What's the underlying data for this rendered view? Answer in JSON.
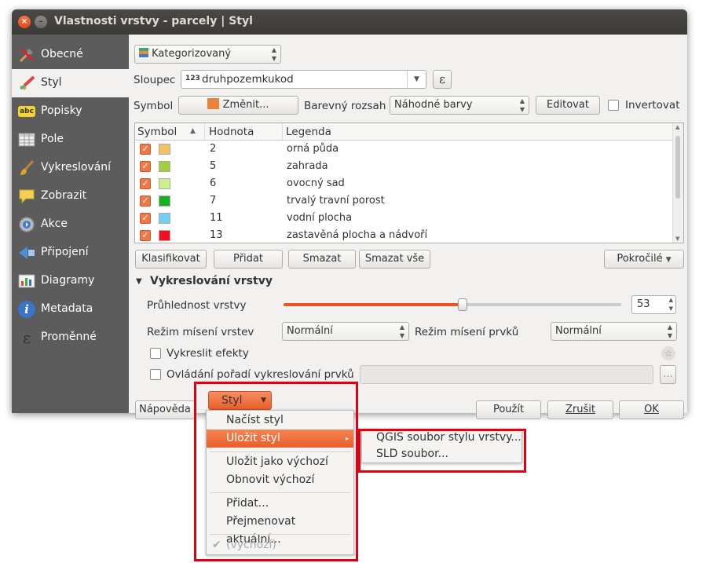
{
  "window": {
    "title": "Vlastnosti vrstvy - parcely | Styl"
  },
  "sidebar": {
    "items": [
      {
        "label": "Obecné",
        "icon": "tools-icon"
      },
      {
        "label": "Styl",
        "icon": "paintbrush-icon",
        "selected": true
      },
      {
        "label": "Popisky",
        "icon": "abc-label-icon",
        "icon_text": "abc"
      },
      {
        "label": "Pole",
        "icon": "table-icon"
      },
      {
        "label": "Vykreslování",
        "icon": "brush-icon"
      },
      {
        "label": "Zobrazit",
        "icon": "speech-bubble-icon"
      },
      {
        "label": "Akce",
        "icon": "gear-play-icon"
      },
      {
        "label": "Připojení",
        "icon": "join-icon"
      },
      {
        "label": "Diagramy",
        "icon": "diagram-icon"
      },
      {
        "label": "Metadata",
        "icon": "info-icon",
        "icon_text": "i"
      },
      {
        "label": "Proměnné",
        "icon": "epsilon-icon",
        "icon_text": "ε"
      }
    ]
  },
  "style": {
    "renderer": "Kategorizovaný",
    "column_label": "Sloupec",
    "column_prefix": "123",
    "column_value": "druhpozemkukod",
    "expr_glyph": "ε",
    "symbol_label": "Symbol",
    "symbol_button": "Změnit...",
    "symbol_color": "#e8823e",
    "ramp_label": "Barevný rozsah",
    "ramp_value": "Náhodné barvy",
    "edit_button": "Editovat",
    "invert_label": "Invertovat"
  },
  "table": {
    "headers": {
      "symbol": "Symbol",
      "value": "Hodnota",
      "legend": "Legenda"
    },
    "rows": [
      {
        "value": "2",
        "legend": "orná půda",
        "color": "#f2c26b"
      },
      {
        "value": "5",
        "legend": "zahrada",
        "color": "#9fd13f"
      },
      {
        "value": "6",
        "legend": "ovocný sad",
        "color": "#cdf08c"
      },
      {
        "value": "7",
        "legend": "trvalý travní porost",
        "color": "#14b023"
      },
      {
        "value": "11",
        "legend": "vodní plocha",
        "color": "#75cff0"
      },
      {
        "value": "13",
        "legend": "zastavěná plocha a nádvoří",
        "color": "#f0101f"
      }
    ]
  },
  "actions": {
    "classify": "Klasifikovat",
    "add": "Přidat",
    "delete": "Smazat",
    "delete_all": "Smazat vše",
    "advanced": "Pokročilé"
  },
  "rendering": {
    "section_title": "Vykreslování vrstvy",
    "opacity_label": "Průhlednost vrstvy",
    "opacity_value": "53",
    "opacity_fraction": 0.53,
    "blend_layer_label": "Režim mísení vrstev",
    "blend_layer_value": "Normální",
    "blend_feature_label": "Režim mísení prvků",
    "blend_feature_value": "Normální",
    "effects_label": "Vykreslit efekty",
    "order_label": "Ovládání pořadí vykreslování prvků",
    "more_button": "..."
  },
  "footer": {
    "help": "Nápověda",
    "style": "Styl",
    "apply": "Použít",
    "cancel": "Zrušit",
    "ok": "OK"
  },
  "style_menu": {
    "load": "Načíst styl",
    "save": "Uložit styl",
    "save_default": "Uložit jako výchozí",
    "restore_default": "Obnovit výchozí",
    "add": "Přidat...",
    "rename": "Přejmenovat aktuální...",
    "current": "(výchozí)"
  },
  "save_submenu": {
    "qgis": "QGIS soubor stylu vrstvy...",
    "sld": "SLD soubor..."
  },
  "colors": {
    "accent": "#e95420",
    "highlight_box": "#e00010"
  }
}
